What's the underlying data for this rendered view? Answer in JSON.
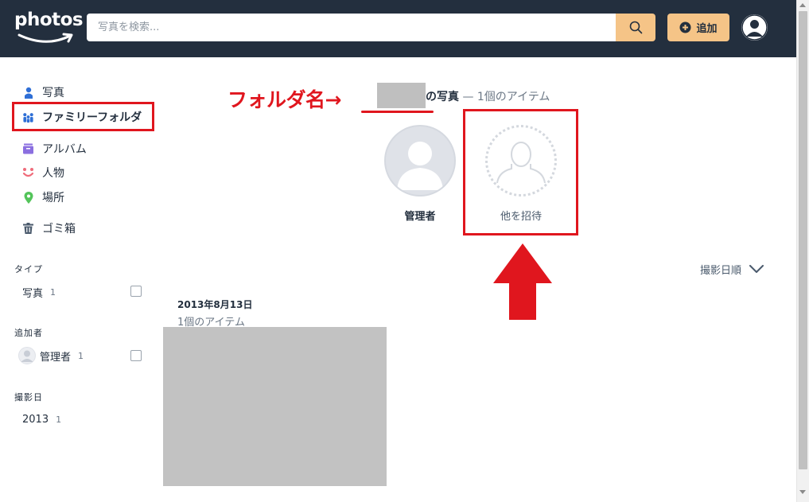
{
  "header": {
    "logo_text": "photos",
    "search_placeholder": "写真を検索...",
    "add_label": "追加"
  },
  "sidebar": {
    "nav": [
      {
        "label": "写真",
        "icon": "person-icon"
      },
      {
        "label": "ファミリーフォルダ",
        "icon": "family-icon",
        "active": true
      },
      {
        "label": "アルバム",
        "icon": "album-icon"
      },
      {
        "label": "人物",
        "icon": "face-icon"
      },
      {
        "label": "場所",
        "icon": "location-pin-icon"
      },
      {
        "label": "ゴミ箱",
        "icon": "trash-icon"
      }
    ],
    "filters": {
      "type": {
        "heading": "タイプ",
        "items": [
          {
            "label": "写真",
            "count": "1"
          }
        ]
      },
      "added_by": {
        "heading": "追加者",
        "items": [
          {
            "label": "管理者",
            "count": "1"
          }
        ]
      },
      "date_taken": {
        "heading": "撮影日",
        "items": [
          {
            "label": "2013",
            "count": "1"
          }
        ]
      }
    }
  },
  "main": {
    "annotation_label": "フォルダ名→",
    "folder_title_suffix": "の写真",
    "folder_item_count": "— 1個のアイテム",
    "members": [
      {
        "label": "管理者"
      },
      {
        "label": "他を招待"
      }
    ],
    "sort_label": "撮影日順",
    "group": {
      "date": "2013年8月13日",
      "count": "1個のアイテム"
    }
  },
  "colors": {
    "header_bg": "#232f3e",
    "accent": "#f5c487",
    "annotation_red": "#e0161e"
  }
}
